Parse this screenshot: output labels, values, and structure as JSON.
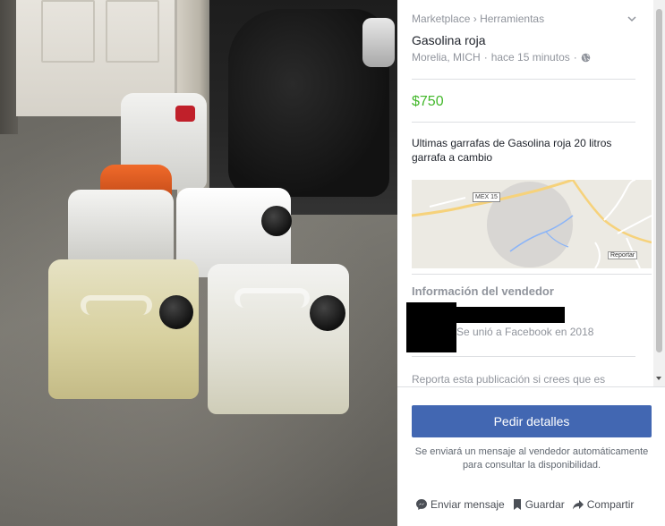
{
  "listing": {
    "breadcrumb": [
      "Marketplace",
      "Herramientas"
    ],
    "breadcrumb_separator": "›",
    "title": "Gasolina roja",
    "location": "Morelia, MICH",
    "meta_separator": "·",
    "posted": "hace 15 minutos",
    "price": "$750",
    "description": "Ultimas garrafas de Gasolina roja 20 litros garrafa a cambio",
    "map": {
      "road_label": "MEX 15",
      "report_label": "Reportar"
    }
  },
  "seller": {
    "heading": "Información del vendedor",
    "joined": "Se unió a Facebook en 2018"
  },
  "report_text": "Reporta esta publicación si crees que es",
  "cta": {
    "label": "Pedir detalles",
    "note": "Se enviará un mensaje al vendedor automáticamente para consultar la disponibilidad."
  },
  "actions": {
    "message": "Enviar mensaje",
    "save": "Guardar",
    "share": "Compartir"
  },
  "icons": {
    "collapse": "chevron-down-icon",
    "privacy": "globe-icon",
    "message": "messenger-icon",
    "save": "bookmark-icon",
    "share": "share-arrow-icon"
  },
  "colors": {
    "price": "#42b72a",
    "cta_bg": "#4267b2",
    "muted_text": "#90949c"
  }
}
